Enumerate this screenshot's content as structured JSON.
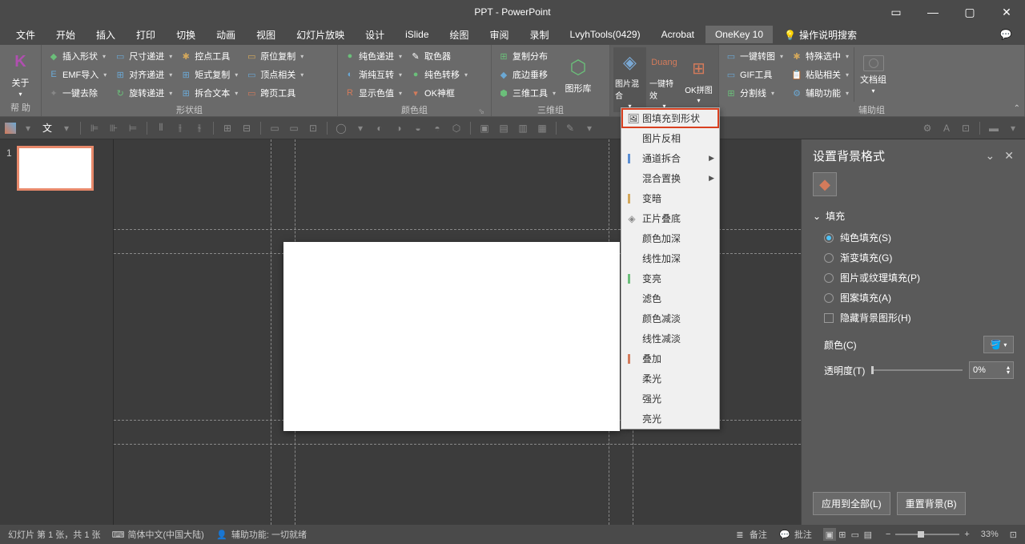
{
  "title": "PPT - PowerPoint",
  "tabs": {
    "items": [
      "文件",
      "开始",
      "插入",
      "打印",
      "切换",
      "动画",
      "视图",
      "幻灯片放映",
      "设计",
      "iSlide",
      "绘图",
      "审阅",
      "录制",
      "LvyhTools(0429)",
      "Acrobat",
      "OneKey 10"
    ],
    "active": 15,
    "tellme": "操作说明搜索"
  },
  "ribbon": {
    "group1": {
      "label": "帮 助",
      "about": "关于"
    },
    "group2": {
      "label": "形状组",
      "items": [
        [
          "插入形状",
          "EMF导入",
          "一键去除"
        ],
        [
          "尺寸递进",
          "对齐递进",
          "旋转递进"
        ],
        [
          "控点工具",
          "矩式复制",
          "拆合文本"
        ],
        [
          "原位复制",
          "顶点相关",
          "跨页工具"
        ]
      ]
    },
    "group3": {
      "label": "颜色组",
      "items": [
        [
          "纯色递进",
          "渐纯互转",
          "显示色值"
        ],
        [
          "取色器",
          "纯色转移",
          "OK神框"
        ]
      ]
    },
    "group4": {
      "label": "三维组",
      "items": [
        [
          "复制分布",
          "底边垂移",
          "三维工具"
        ]
      ],
      "lib": "图形库"
    },
    "group5": {
      "blend": "图片混合",
      "effects": "一键特效",
      "ok": "OK拼图"
    },
    "group6": {
      "label": "辅助组",
      "items": [
        [
          "一键转图",
          "GIF工具",
          "分割线"
        ],
        [
          "特殊选中",
          "粘贴相关",
          "辅助功能"
        ]
      ],
      "doc": "文档组"
    }
  },
  "dropdown": {
    "items": [
      {
        "label": "图填充到形状",
        "highlighted": true,
        "icon": "picture"
      },
      {
        "label": "图片反相"
      },
      {
        "label": "通道拆合",
        "arrow": true,
        "mark": "#5b8fd4"
      },
      {
        "label": "混合置换",
        "arrow": true
      },
      {
        "label": "变暗",
        "mark": "#d4a85b"
      },
      {
        "label": "正片叠底",
        "icon": "diamond"
      },
      {
        "label": "颜色加深"
      },
      {
        "label": "线性加深"
      },
      {
        "label": "变亮",
        "mark": "#6bbf7a"
      },
      {
        "label": "滤色"
      },
      {
        "label": "颜色减淡"
      },
      {
        "label": "线性减淡"
      },
      {
        "label": "叠加",
        "mark": "#d47b5b"
      },
      {
        "label": "柔光"
      },
      {
        "label": "强光"
      },
      {
        "label": "亮光"
      }
    ]
  },
  "format_pane": {
    "title": "设置背景格式",
    "section": "填充",
    "options": [
      "纯色填充(S)",
      "渐变填充(G)",
      "图片或纹理填充(P)",
      "图案填充(A)"
    ],
    "checkbox": "隐藏背景图形(H)",
    "color_label": "颜色(C)",
    "transparency_label": "透明度(T)",
    "transparency_value": "0%",
    "apply_all": "应用到全部(L)",
    "reset": "重置背景(B)"
  },
  "statusbar": {
    "slide": "幻灯片 第 1 张，共 1 张",
    "lang": "简体中文(中国大陆)",
    "access": "辅助功能: 一切就绪",
    "notes": "备注",
    "comments": "批注",
    "zoom": "33%"
  },
  "slidepanel": {
    "num": "1"
  }
}
